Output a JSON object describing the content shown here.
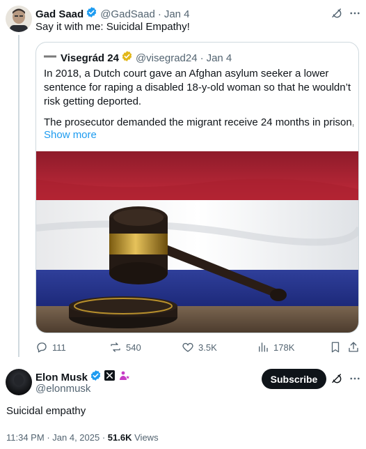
{
  "parent_tweet": {
    "author_name": "Gad Saad",
    "author_handle": "@GadSaad",
    "date": "Jan 4",
    "text": "Say it with me: Suicidal Empathy!",
    "quoted": {
      "author_name": "Visegrád 24",
      "author_handle": "@visegrad24",
      "date": "Jan 4",
      "paragraph_1": "In 2018, a Dutch court gave an Afghan asylum seeker a lower sentence for raping a disabled 18-y-old woman so that he wouldn’t risk getting deported.",
      "paragraph_2": "The prosecutor demanded the migrant receive 24 months in prison, b...",
      "show_more": "Show more"
    },
    "stats": {
      "replies": "111",
      "reposts": "540",
      "likes": "3.5K",
      "views": "178K"
    }
  },
  "main_tweet": {
    "author_name": "Elon Musk",
    "author_handle": "@elonmusk",
    "subscribe_label": "Subscribe",
    "text": "Suicidal empathy",
    "time": "11:34 PM",
    "date": "Jan 4, 2025",
    "views_count": "51.6K",
    "views_label": "Views"
  },
  "colors": {
    "accent_blue": "#1d9bf0",
    "gold_badge": "#e2b719",
    "text_secondary": "#536471"
  }
}
